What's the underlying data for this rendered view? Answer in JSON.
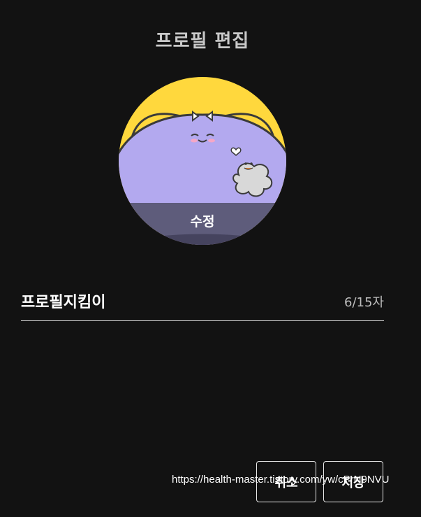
{
  "dialog": {
    "title": "프로필 편집"
  },
  "avatar": {
    "edit_label": "수정",
    "colors": {
      "background": "#ffd83d",
      "body": "#b3a9ef",
      "outline": "#3a3a3a"
    }
  },
  "nickname": {
    "value": "프로필지킴이",
    "char_count": "6/15자"
  },
  "buttons": {
    "cancel_label": "취소",
    "save_label": "저장"
  },
  "watermark": {
    "text": "https://health-master.tistory.com/yw/cPrN9NVU"
  },
  "theme": {
    "page_background": "#121212",
    "text": "#ffffff",
    "muted_text": "#bdbdbd"
  }
}
